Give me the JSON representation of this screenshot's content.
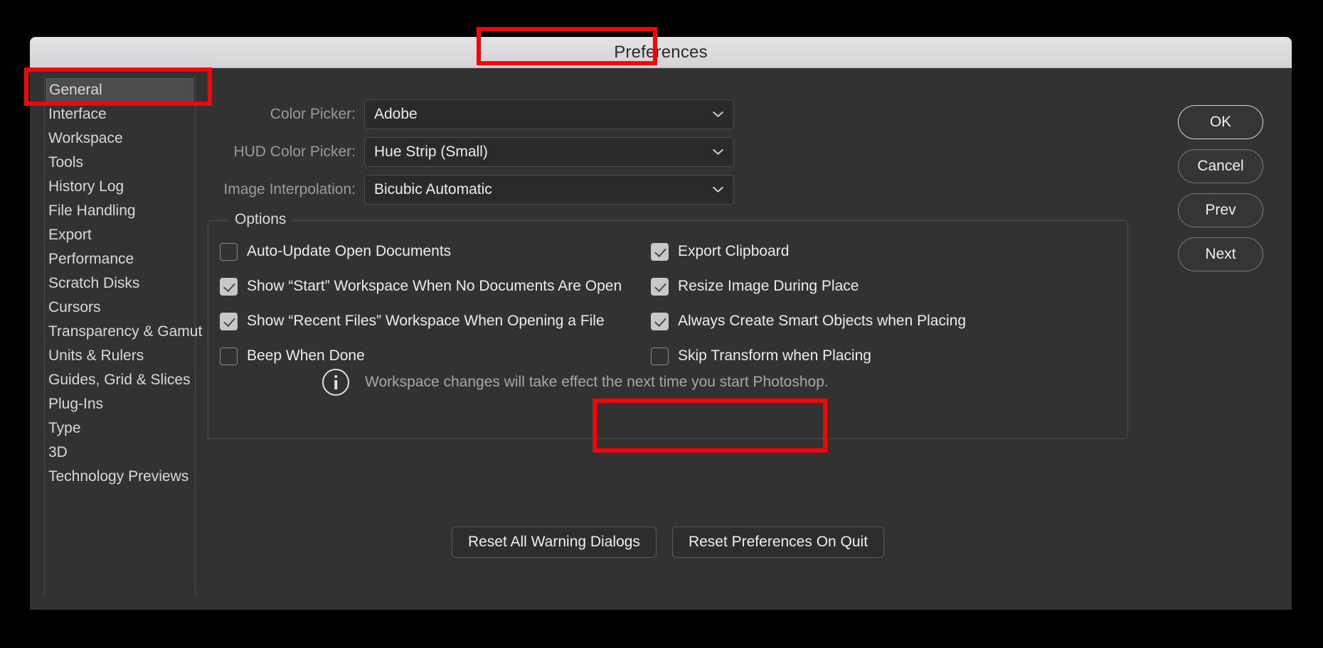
{
  "window": {
    "title": "Preferences"
  },
  "sidebar": {
    "items": [
      {
        "label": "General",
        "selected": true
      },
      {
        "label": "Interface",
        "selected": false
      },
      {
        "label": "Workspace",
        "selected": false
      },
      {
        "label": "Tools",
        "selected": false
      },
      {
        "label": "History Log",
        "selected": false
      },
      {
        "label": "File Handling",
        "selected": false
      },
      {
        "label": "Export",
        "selected": false
      },
      {
        "label": "Performance",
        "selected": false
      },
      {
        "label": "Scratch Disks",
        "selected": false
      },
      {
        "label": "Cursors",
        "selected": false
      },
      {
        "label": "Transparency & Gamut",
        "selected": false
      },
      {
        "label": "Units & Rulers",
        "selected": false
      },
      {
        "label": "Guides, Grid & Slices",
        "selected": false
      },
      {
        "label": "Plug-Ins",
        "selected": false
      },
      {
        "label": "Type",
        "selected": false
      },
      {
        "label": "3D",
        "selected": false
      },
      {
        "label": "Technology Previews",
        "selected": false
      }
    ]
  },
  "form": {
    "rows": [
      {
        "label": "Color Picker:",
        "value": "Adobe"
      },
      {
        "label": "HUD Color Picker:",
        "value": "Hue Strip (Small)"
      },
      {
        "label": "Image Interpolation:",
        "value": "Bicubic Automatic"
      }
    ]
  },
  "options": {
    "legend": "Options",
    "left_column": [
      {
        "label": "Auto-Update Open Documents",
        "checked": false
      },
      {
        "label": "Show “Start” Workspace When No Documents Are Open",
        "checked": true
      },
      {
        "label": "Show “Recent Files” Workspace When Opening a File",
        "checked": true
      },
      {
        "label": "Beep When Done",
        "checked": false
      }
    ],
    "right_column": [
      {
        "label": "Export Clipboard",
        "checked": true
      },
      {
        "label": "Resize Image During Place",
        "checked": true
      },
      {
        "label": "Always Create Smart Objects when Placing",
        "checked": true
      },
      {
        "label": "Skip Transform when Placing",
        "checked": false
      }
    ],
    "notice": {
      "icon": "info-icon",
      "text": "Workspace changes will take effect the next time you start Photoshop."
    }
  },
  "bottom_buttons": [
    {
      "label": "Reset All Warning Dialogs"
    },
    {
      "label": "Reset Preferences On Quit"
    }
  ],
  "actions": [
    {
      "label": "OK",
      "default": true
    },
    {
      "label": "Cancel",
      "default": false
    },
    {
      "label": "Prev",
      "default": false
    },
    {
      "label": "Next",
      "default": false
    }
  ],
  "annotations": {
    "color": "#fb0007",
    "boxes": [
      {
        "target": "window-title"
      },
      {
        "target": "sidebar-item-general"
      },
      {
        "target": "reset-preferences-on-quit-button"
      }
    ]
  }
}
